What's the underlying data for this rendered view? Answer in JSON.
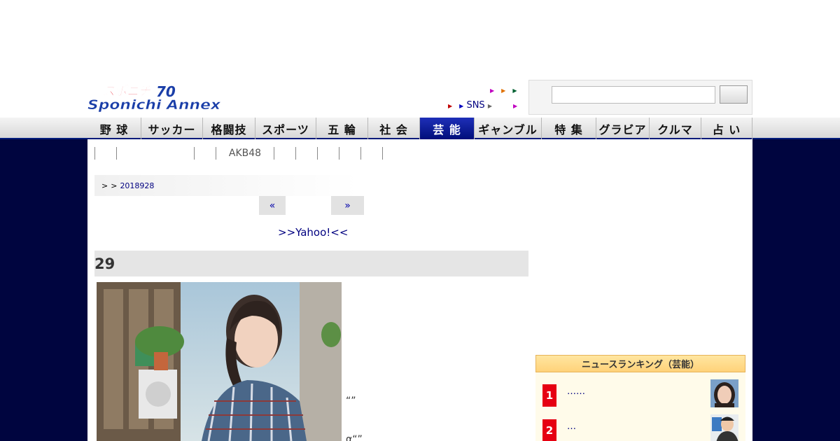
{
  "logo": {
    "line1": "スポニチ",
    "line2": "Sponichi Annex",
    "anniversary": "70"
  },
  "util": {
    "row1": [
      "",
      "",
      ""
    ],
    "row2": [
      "",
      "SNS",
      ""
    ],
    "row1_colors": [
      "#c000c0",
      "#e07000",
      "#006030"
    ],
    "row2_colors": [
      "#c00000",
      "#0000c0",
      "#c000c0"
    ]
  },
  "search": {
    "value": "",
    "button_label": ""
  },
  "nav": {
    "items": [
      "野 球",
      "サッカー",
      "格闘技",
      "スポーツ",
      "五 輪",
      "社 会",
      "芸 能",
      "ギャンブル",
      "特 集",
      "グラビア",
      "クルマ",
      "占 い"
    ],
    "active_index": 6
  },
  "subnav": {
    "items": [
      "",
      "",
      "",
      "",
      "AKB48",
      "",
      "",
      "",
      "",
      "",
      ""
    ]
  },
  "breadcrumb": {
    "sep1": ">",
    "sep2": ">",
    "date": "2018928"
  },
  "pager": {
    "prev": "«",
    "next": "»"
  },
  "yahoo": {
    "text": ">>Yahoo!<<"
  },
  "article": {
    "headline": "29",
    "quote1": "“”",
    "quote2": "α“”"
  },
  "ranking": {
    "title": "ニュースランキング（芸能）",
    "items": [
      {
        "rank": "1",
        "text": "……"
      },
      {
        "rank": "2",
        "text": "…"
      }
    ]
  },
  "colors": {
    "navy": "#00053f",
    "accent": "#000e7a",
    "rank_red": "#e60012"
  }
}
